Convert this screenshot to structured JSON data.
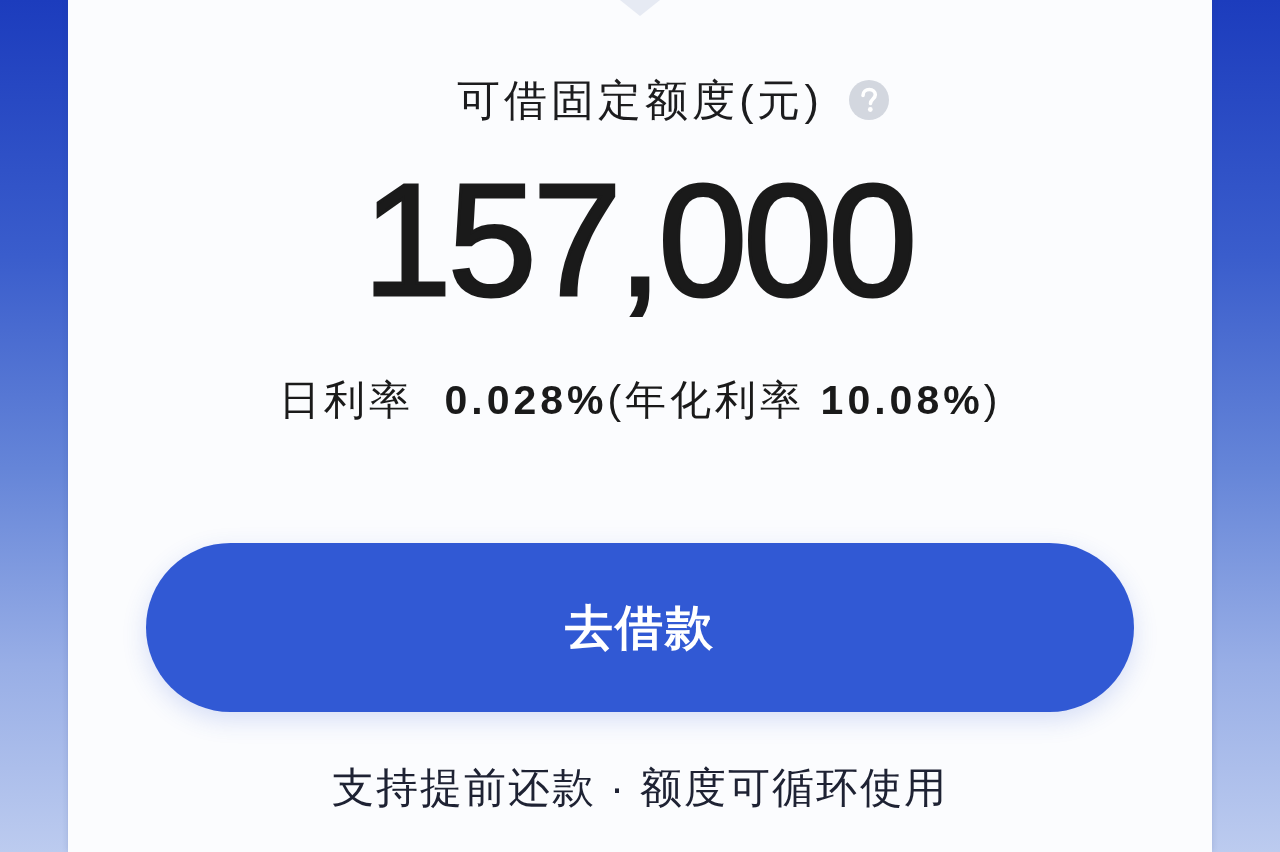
{
  "card": {
    "title": "可借固定额度(元)",
    "amount": "157,000",
    "rate": "日利率  **0.028%**(年化利率 **10.08%**)",
    "button": "去借款",
    "footnote": "支持提前还款 · 额度可循环使用"
  }
}
